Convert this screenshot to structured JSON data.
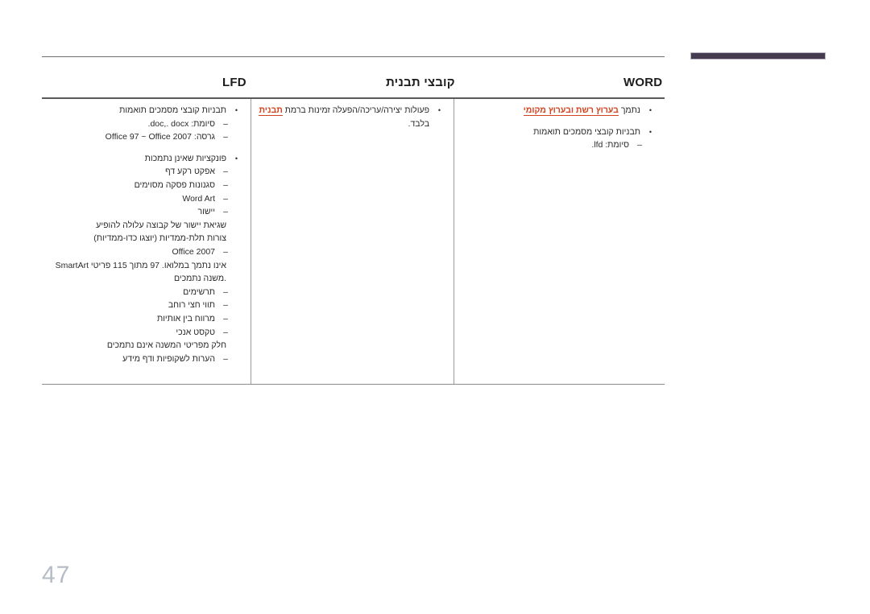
{
  "page": {
    "number": "47"
  },
  "decoration": {
    "rule_color": "#6e6e70",
    "accent_bar_color": "#453c52",
    "highlight_color": "#d2431f"
  },
  "table": {
    "headers": {
      "lfd": "LFD",
      "center": "קובצי תבנית",
      "word": "WORD"
    },
    "columns": {
      "lfd": {
        "lines": [
          {
            "level": 1,
            "text": "נתמך בערוץ רשת ובערוץ מקומי",
            "plain": "נתמך ",
            "highlight": "בערוץ רשת ובערוץ מקומי"
          },
          {
            "level": 0,
            "text": ""
          },
          {
            "level": 1,
            "text": "תבניות קובצי מסמכים תואמות"
          },
          {
            "level": 2,
            "text": "סיומת: lfd."
          }
        ]
      },
      "center": {
        "lines": [
          {
            "level": 1,
            "text": "פעולות יצירה/עריכה/הפעלה זמינות ברמת תבנית",
            "pre": "פעולות יצירה/עריכה/הפעלה זמינות ברמת ",
            "highlight": "תבנית"
          },
          {
            "level": 0,
            "text": "בלבד."
          }
        ]
      },
      "word": {
        "lines": [
          {
            "level": 1,
            "text": "תבניות קובצי מסמכים תואמות"
          },
          {
            "level": 2,
            "text": "סיומת: doc,. docx."
          },
          {
            "level": 2,
            "text": "גרסה: Office 97 ~ Office 2007"
          },
          {
            "level": 0,
            "text": ""
          },
          {
            "level": 1,
            "text": "פונקציות שאינן נתמכות"
          },
          {
            "level": 2,
            "text": "אפקט רקע דף"
          },
          {
            "level": 2,
            "text": "סגנונות פסקה מסוימים"
          },
          {
            "level": 2,
            "text": "Word Art"
          },
          {
            "level": 2,
            "text": "יישור"
          },
          {
            "level": 0,
            "text": "שגיאת יישור של קבוצה עלולה להופיע"
          },
          {
            "level": 0,
            "text": "צורות תלת-ממדיות (יוצגו כדו-ממדיות)"
          },
          {
            "level": 2,
            "text": "Office 2007"
          },
          {
            "level": 0,
            "text": "SmartArt אינו נתמך במלואו. 97 מתוך 115 פריטי משנה נתמכים."
          },
          {
            "level": 2,
            "text": "תרשימים"
          },
          {
            "level": 2,
            "text": "תווי חצי רוחב"
          },
          {
            "level": 2,
            "text": "מרווח בין אותיות"
          },
          {
            "level": 2,
            "text": "טקסט אנכי"
          },
          {
            "level": 0,
            "text": "חלק מפריטי המשנה אינם נתמכים"
          },
          {
            "level": 2,
            "text": "הערות לשקופיות ודף מידע"
          }
        ]
      }
    }
  }
}
